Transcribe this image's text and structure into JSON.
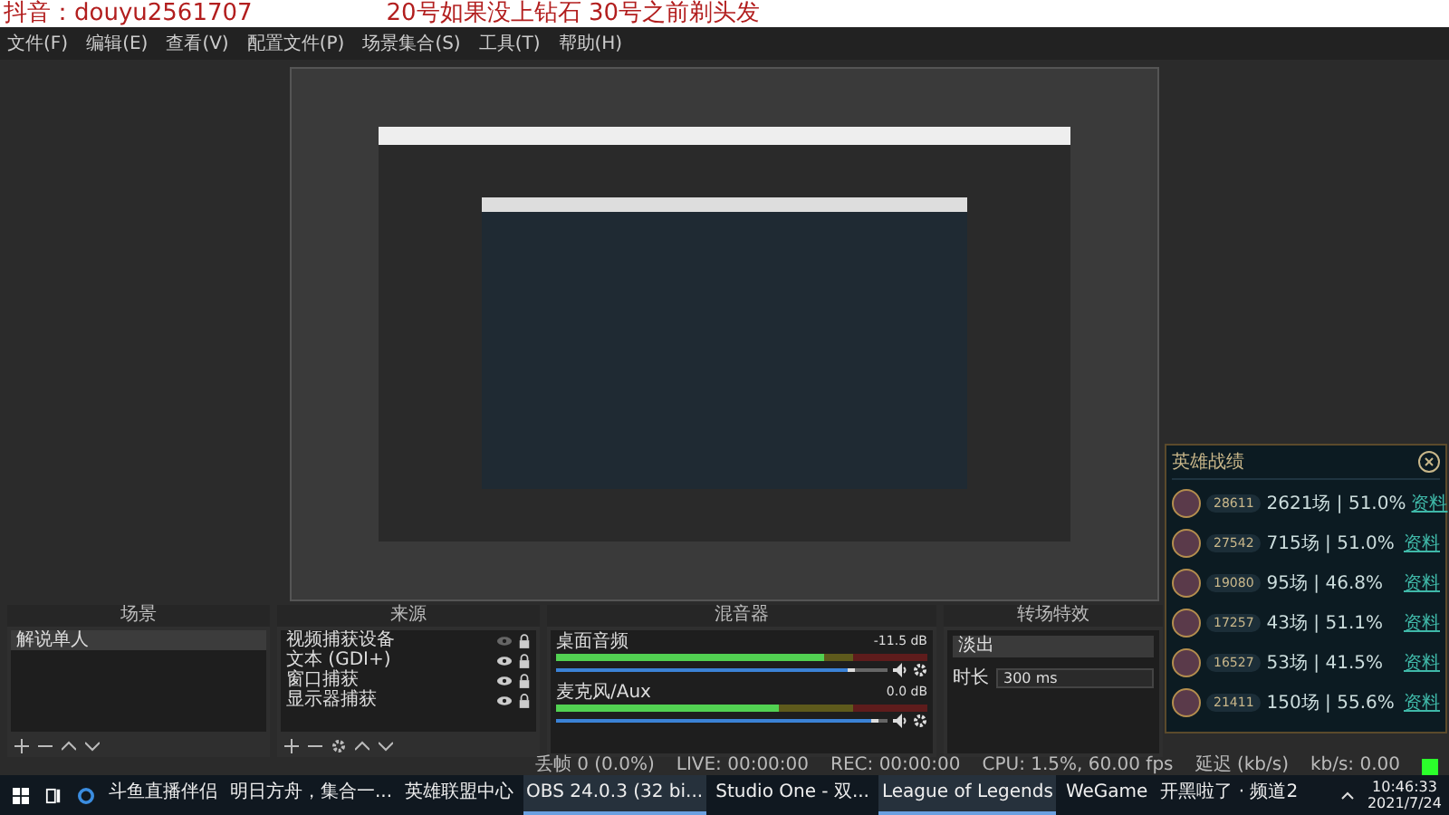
{
  "overlay_caption": {
    "account": "抖音：douyu2561707",
    "message": "20号如果没上钻石  30号之前剃头发"
  },
  "menu": [
    "文件(F)",
    "编辑(E)",
    "查看(V)",
    "配置文件(P)",
    "场景集合(S)",
    "工具(T)",
    "帮助(H)"
  ],
  "docks": {
    "scenes": {
      "title": "场景",
      "items": [
        {
          "label": "解说单人",
          "selected": true
        }
      ]
    },
    "sources": {
      "title": "来源",
      "items": [
        {
          "label": "视频捕获设备",
          "visible": false,
          "locked": true
        },
        {
          "label": "文本 (GDI+)",
          "visible": true,
          "locked": true
        },
        {
          "label": "窗口捕获",
          "visible": true,
          "locked": true
        },
        {
          "label": "显示器捕获",
          "visible": true,
          "locked": true
        }
      ]
    },
    "mixer": {
      "title": "混音器",
      "channels": [
        {
          "name": "桌面音频",
          "reading": "-11.5 dB",
          "meter": {
            "level": 0.72
          },
          "slider": {
            "level": 0.88
          }
        },
        {
          "name": "麦克风/Aux",
          "reading": "0.0 dB",
          "meter": {
            "level": 0.6
          },
          "slider": {
            "level": 0.95
          }
        }
      ]
    },
    "transitions": {
      "title": "转场特效",
      "transition": "淡出",
      "duration_label": "时长",
      "duration": "300 ms"
    }
  },
  "status_bar": [
    "丢帧 0 (0.0%)",
    "LIVE: 00:00:00",
    "REC: 00:00:00",
    "CPU: 1.5%, 60.00 fps",
    "延迟 (kb/s)",
    "kb/s: 0.00"
  ],
  "hero_stats": {
    "title": "英雄战绩",
    "rows": [
      {
        "score": "28611",
        "record": "2621场 | 51.0%",
        "link": "资料"
      },
      {
        "score": "27542",
        "record": "715场 | 51.0%",
        "link": "资料"
      },
      {
        "score": "19080",
        "record": "95场 | 46.8%",
        "link": "资料"
      },
      {
        "score": "17257",
        "record": "43场 | 51.1%",
        "link": "资料"
      },
      {
        "score": "16527",
        "record": "53场 | 41.5%",
        "link": "资料"
      },
      {
        "score": "21411",
        "record": "150场 | 55.6%",
        "link": "资料"
      }
    ]
  },
  "taskbar": {
    "apps": [
      {
        "label": "斗鱼直播伴侣",
        "active": false
      },
      {
        "label": "明日方舟，集合一...",
        "active": false
      },
      {
        "label": "英雄联盟中心",
        "active": false
      },
      {
        "label": "OBS 24.0.3 (32 bi...",
        "active": true
      },
      {
        "label": "Studio One - 双...",
        "active": false
      },
      {
        "label": "League of Legends",
        "active": true
      },
      {
        "label": "WeGame",
        "active": false
      },
      {
        "label": "开黑啦了 · 频道2",
        "active": false
      }
    ],
    "time": "10:46:33",
    "date": "2021/7/24"
  }
}
